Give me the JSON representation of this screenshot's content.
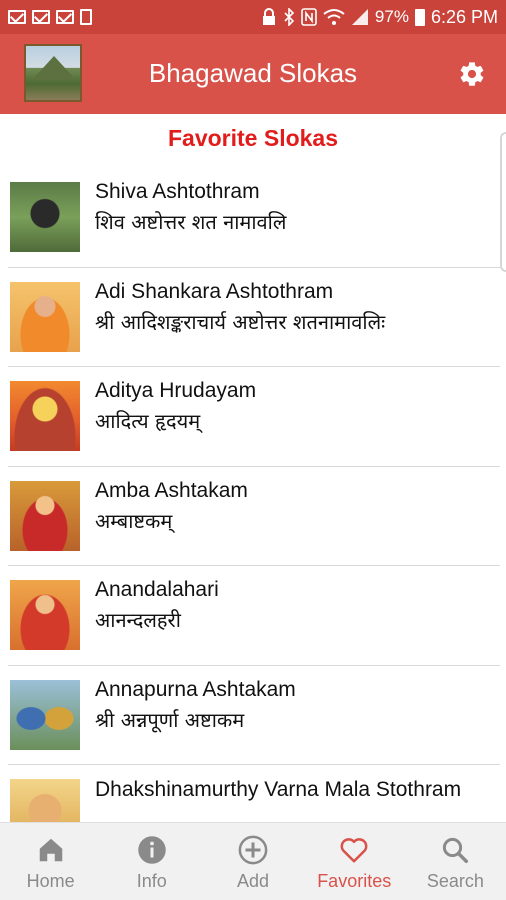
{
  "status_bar": {
    "battery": "97%",
    "time": "6:26 PM"
  },
  "app_bar": {
    "title": "Bhagawad Slokas"
  },
  "section": {
    "title": "Favorite Slokas"
  },
  "slokas": [
    {
      "title": "Shiva Ashtothram",
      "subtitle": "शिव अष्टोत्तर शत नामावलि"
    },
    {
      "title": "Adi Shankara Ashtothram",
      "subtitle": "श्री आदिशङ्कराचार्य अष्टोत्तर शतनामावलिः"
    },
    {
      "title": "Aditya Hrudayam",
      "subtitle": "आदित्य हृदयम्"
    },
    {
      "title": "Amba Ashtakam",
      "subtitle": "अम्बाष्टकम्"
    },
    {
      "title": "Anandalahari",
      "subtitle": "आनन्दलहरी"
    },
    {
      "title": "Annapurna Ashtakam",
      "subtitle": "श्री अन्नपूर्णा अष्टाकम"
    },
    {
      "title": "Dhakshinamurthy Varna Mala Stothram",
      "subtitle": ""
    }
  ],
  "bottom_nav": {
    "home": "Home",
    "info": "Info",
    "add": "Add",
    "favorites": "Favorites",
    "search": "Search"
  },
  "colors": {
    "app_bar": "#d9524a",
    "status_bar": "#c9433b",
    "accent": "#e21b1b",
    "active_tab": "#d9524a"
  }
}
